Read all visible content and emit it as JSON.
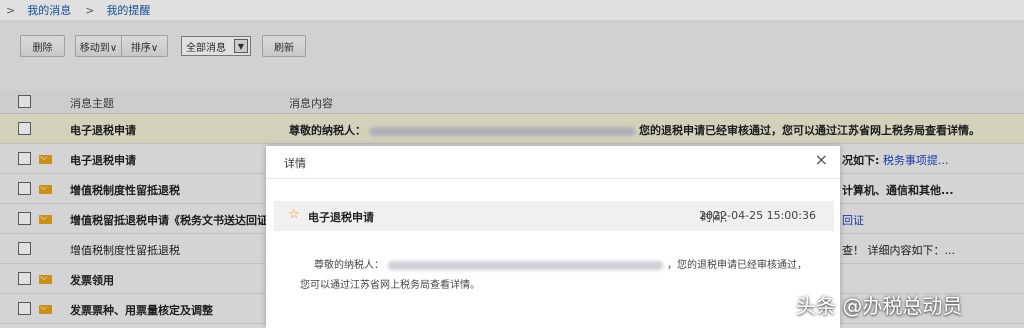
{
  "breadcrumb": {
    "items": [
      "我的消息",
      "我的提醒"
    ],
    "separator": ">"
  },
  "toolbar": {
    "delete_label": "删除",
    "move_label": "移动到∨",
    "sort_label": "排序∨",
    "filter_value": "全部消息",
    "refresh_label": "刷新"
  },
  "table": {
    "columns": [
      "消息主题",
      "消息内容"
    ],
    "rows": [
      {
        "subject": "电子退税申请",
        "bold": true,
        "unread": false,
        "content_prefix": "尊敬的纳税人：",
        "content_suffix": "您的退税申请已经审核通过，您可以通过江苏省网上税务局查看详情。",
        "right": ""
      },
      {
        "subject": "电子退税申请",
        "bold": true,
        "unread": true,
        "content_prefix": "",
        "content_suffix": "",
        "right": "况如下:",
        "right_link": "税务事项提..."
      },
      {
        "subject": "增值税制度性留抵退税",
        "bold": true,
        "unread": true,
        "content_prefix": "",
        "content_suffix": "",
        "right": "计算机、通信和其他...",
        "right_link": ""
      },
      {
        "subject": "增值税留抵退税申请《税务文书送达回证》",
        "bold": true,
        "unread": true,
        "content_prefix": "",
        "content_suffix": "",
        "right": "",
        "right_link": "回证"
      },
      {
        "subject": "增值税制度性留抵退税",
        "bold": false,
        "unread": false,
        "content_prefix": "",
        "content_suffix": "",
        "right": "查！ 详细内容如下：...",
        "right_link": ""
      },
      {
        "subject": "发票领用",
        "bold": true,
        "unread": true,
        "content_prefix": "",
        "content_suffix": "",
        "right": "",
        "right_link": ""
      },
      {
        "subject": "发票票种、用票量核定及调整",
        "bold": true,
        "unread": true,
        "content_prefix": "",
        "content_suffix": "",
        "right": "",
        "right_link": ""
      }
    ]
  },
  "modal": {
    "title": "详情",
    "close_glyph": "×",
    "message_title": "电子退税申请",
    "time_label": "时间：",
    "time_value": "2022-04-25 15:00:36",
    "greeting": "尊敬的纳税人：",
    "body_part1": "，您的退税申请已经审核通过，",
    "body_part2": "您可以通过江苏省网上税务局查看详情。"
  },
  "watermark": "头条 @办税总动员",
  "colors": {
    "link": "#1a5aa8",
    "highlight_row": "#efeed6",
    "mail_icon": "#e9a11d"
  }
}
